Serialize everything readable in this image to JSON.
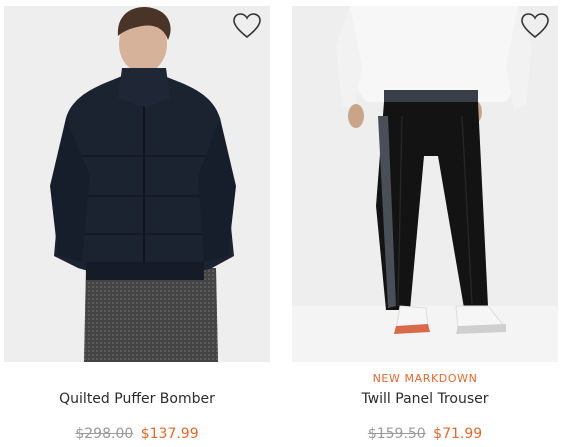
{
  "colors": {
    "sale_price": "#e2682f",
    "badge": "#e2682f",
    "original_price": "#9a9a9a",
    "image_background": "#efefef"
  },
  "products": [
    {
      "name": "Quilted Puffer Bomber",
      "badge": "",
      "original_price": "$298.00",
      "sale_price": "$137.99",
      "favorite_icon": "heart-outline-icon"
    },
    {
      "name": "Twill Panel Trouser",
      "badge": "NEW MARKDOWN",
      "original_price": "$159.50",
      "sale_price": "$71.99",
      "favorite_icon": "heart-outline-icon"
    }
  ]
}
